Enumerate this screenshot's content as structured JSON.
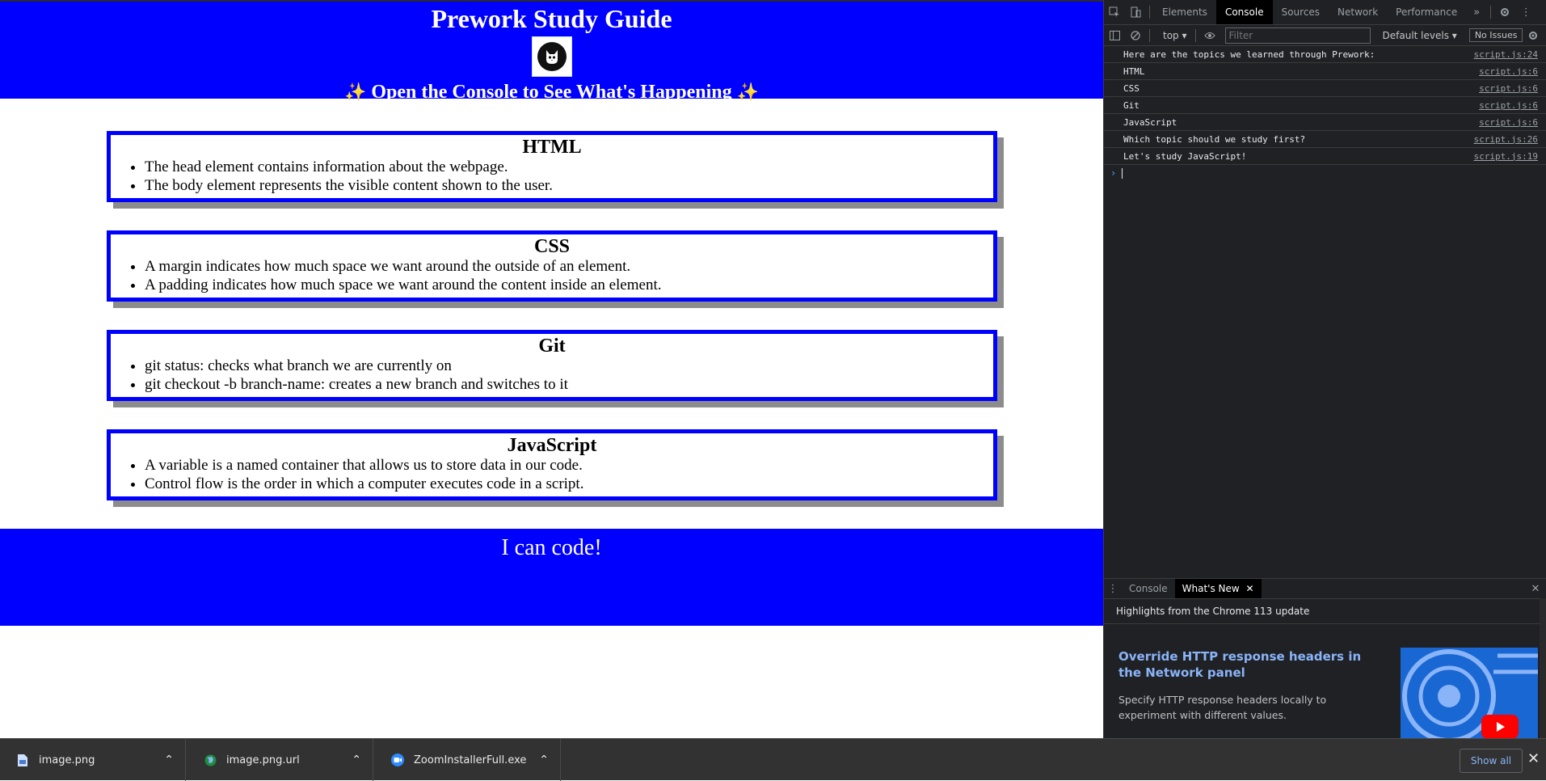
{
  "site": {
    "title": "Prework Study Guide",
    "subtitle": "Open the Console to See What's Happening",
    "spark_left": "✨",
    "spark_right": "✨",
    "footer": "I can code!"
  },
  "topics": [
    {
      "heading": "HTML",
      "items": [
        "The head element contains information about the webpage.",
        "The body element represents the visible content shown to the user."
      ]
    },
    {
      "heading": "CSS",
      "items": [
        "A margin indicates how much space we want around the outside of an element.",
        "A padding indicates how much space we want around the content inside an element."
      ]
    },
    {
      "heading": "Git",
      "items": [
        "git status: checks what branch we are currently on",
        "git checkout -b branch-name: creates a new branch and switches to it"
      ]
    },
    {
      "heading": "JavaScript",
      "items": [
        "A variable is a named container that allows us to store data in our code.",
        "Control flow is the order in which a computer executes code in a script."
      ]
    }
  ],
  "devtools": {
    "tabs": [
      "Elements",
      "Console",
      "Sources",
      "Network",
      "Performance"
    ],
    "more": "»",
    "toolbar": {
      "context": "top ▾",
      "filter_placeholder": "Filter",
      "levels": "Default levels ▾",
      "issues": "No Issues"
    },
    "logs": [
      {
        "msg": "Here are the topics we learned through Prework:",
        "src": "script.js:24"
      },
      {
        "msg": "HTML",
        "src": "script.js:6"
      },
      {
        "msg": "CSS",
        "src": "script.js:6"
      },
      {
        "msg": "Git",
        "src": "script.js:6"
      },
      {
        "msg": "JavaScript",
        "src": "script.js:6"
      },
      {
        "msg": "Which topic should we study first?",
        "src": "script.js:26"
      },
      {
        "msg": "Let's study JavaScript!",
        "src": "script.js:19"
      }
    ],
    "prompt": "›",
    "drawer": {
      "tabs": [
        "Console",
        "What's New"
      ],
      "heading": "Highlights from the Chrome 113 update",
      "feature_title": "Override HTTP response headers in the Network panel",
      "feature_desc": "Specify HTTP response headers locally to experiment with different values."
    }
  },
  "downloads": {
    "items": [
      "image.png",
      "image.png.url",
      "ZoomInstallerFull.exe"
    ],
    "show_all": "Show all",
    "close": "✕"
  },
  "colors": {
    "brand_blue": "#0000ff",
    "devtools_bg": "#202124",
    "link_blue": "#8ab4f8"
  }
}
